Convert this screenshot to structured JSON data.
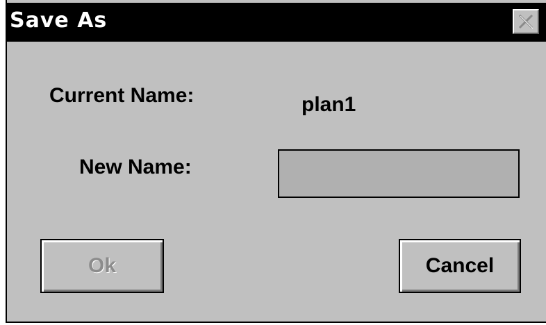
{
  "dialog": {
    "title": "Save As",
    "close_icon": "close-x-icon",
    "current_name_label": "Current Name:",
    "current_name_value": "plan1",
    "new_name_label": "New Name:",
    "new_name_value": "",
    "ok_label": "Ok",
    "ok_enabled": false,
    "cancel_label": "Cancel"
  }
}
